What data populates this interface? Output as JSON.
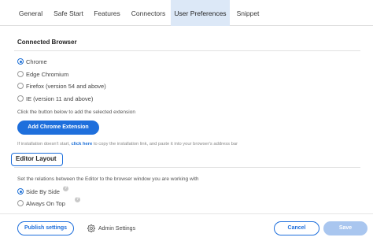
{
  "tabs": [
    {
      "label": "General",
      "active": false
    },
    {
      "label": "Safe Start",
      "active": false
    },
    {
      "label": "Features",
      "active": false
    },
    {
      "label": "Connectors",
      "active": false
    },
    {
      "label": "User Preferences",
      "active": true
    },
    {
      "label": "Snippet",
      "active": false
    }
  ],
  "connected_browser": {
    "title": "Connected Browser",
    "options": [
      {
        "label": "Chrome",
        "checked": true
      },
      {
        "label": "Edge Chromium",
        "checked": false
      },
      {
        "label": "Firefox (version 54 and above)",
        "checked": false
      },
      {
        "label": "IE (version 11 and above)",
        "checked": false
      }
    ],
    "instruction": "Click the button below to add the selected extension",
    "button_label": "Add Chrome Extension",
    "hint_prefix": "If installation doesn't start,",
    "hint_link": "click here",
    "hint_suffix": "to copy the installation link, and paste it into your browser's address bar"
  },
  "editor_layout": {
    "title": "Editor Layout",
    "description": "Set the relations between the Editor to the browser window you are working with",
    "options": [
      {
        "label": "Side By Side",
        "checked": true
      },
      {
        "label": "Always On Top",
        "checked": false
      }
    ],
    "help_icon": "?"
  },
  "footer": {
    "publish_label": "Publish settings",
    "admin_label": "Admin Settings",
    "cancel_label": "Cancel",
    "save_label": "Save"
  },
  "colors": {
    "accent": "#1e6fdc",
    "active_tab_bg": "#dce8f7",
    "save_disabled": "#a9c6ef"
  },
  "icons": {
    "admin": "gear-icon",
    "help": "help-icon"
  }
}
